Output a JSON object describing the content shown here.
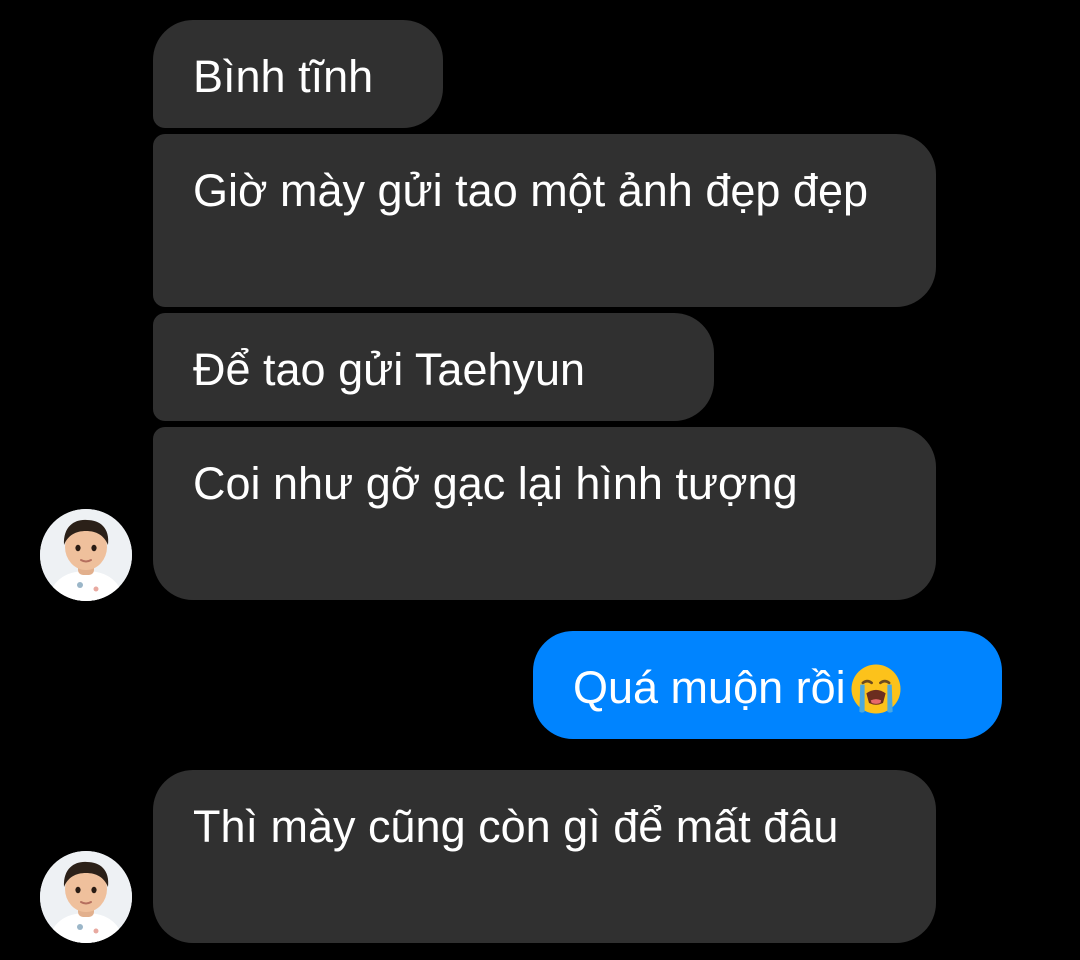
{
  "conversation": {
    "messages": [
      {
        "sender": "other",
        "text": "Bình tĩnh"
      },
      {
        "sender": "other",
        "text": "Giờ mày gửi tao một ảnh đẹp đẹp"
      },
      {
        "sender": "other",
        "text": "Để tao gửi Taehyun"
      },
      {
        "sender": "other",
        "text": "Coi như gỡ gạc lại hình tượng"
      },
      {
        "sender": "me",
        "text": "Quá muộn rồi",
        "emoji": "loudly-crying-face-icon"
      },
      {
        "sender": "other",
        "text": "Thì mày cũng còn gì để mất đâu"
      }
    ]
  },
  "colors": {
    "background": "#000000",
    "incoming_bubble": "#303030",
    "outgoing_bubble": "#0084ff",
    "text": "#ffffff"
  }
}
